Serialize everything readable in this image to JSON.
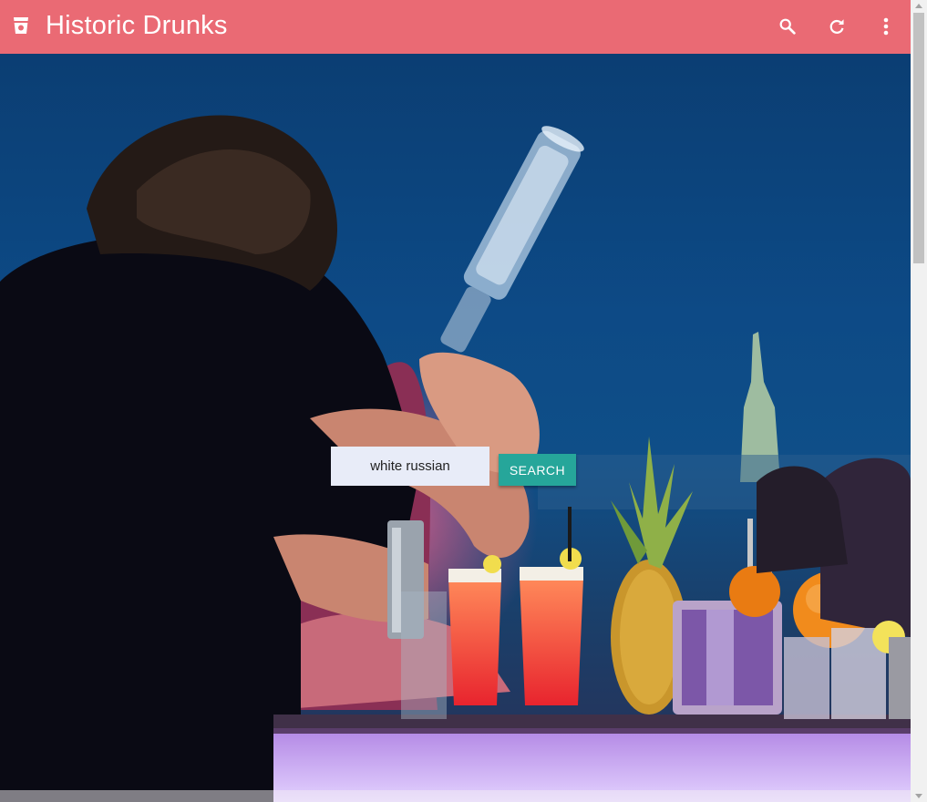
{
  "app": {
    "title": "Historic Drunks",
    "brand_color": "#ea6a74",
    "logo_icon": "cup-icon"
  },
  "toolbar": {
    "actions": [
      {
        "icon": "search-icon"
      },
      {
        "icon": "refresh-icon"
      },
      {
        "icon": "more-vert-icon"
      }
    ]
  },
  "hero": {
    "background": "photo of a bartender pouring a bottle at a bar with cocktails and fruit at night"
  },
  "search": {
    "value": "white russian",
    "button_label": "SEARCH",
    "button_color": "#26a69a"
  }
}
